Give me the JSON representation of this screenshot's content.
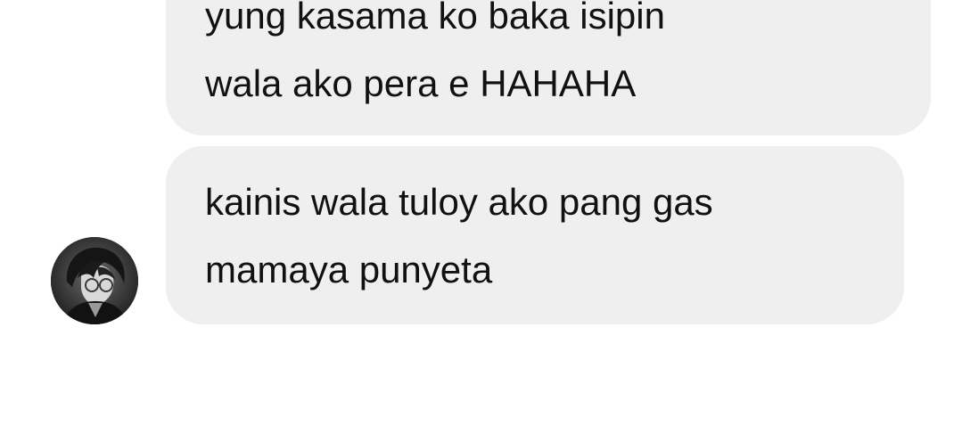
{
  "messages": [
    {
      "lines": [
        "yung kasama ko baka isipin",
        "wala ako pera e HAHAHA"
      ]
    },
    {
      "lines": [
        "kainis wala tuloy ako pang gas",
        "mamaya punyeta"
      ]
    }
  ],
  "colors": {
    "background": "#ffffff",
    "bubble": "#efeff0",
    "text": "#111111"
  },
  "avatar": {
    "icon": "user-avatar-anime-character"
  }
}
